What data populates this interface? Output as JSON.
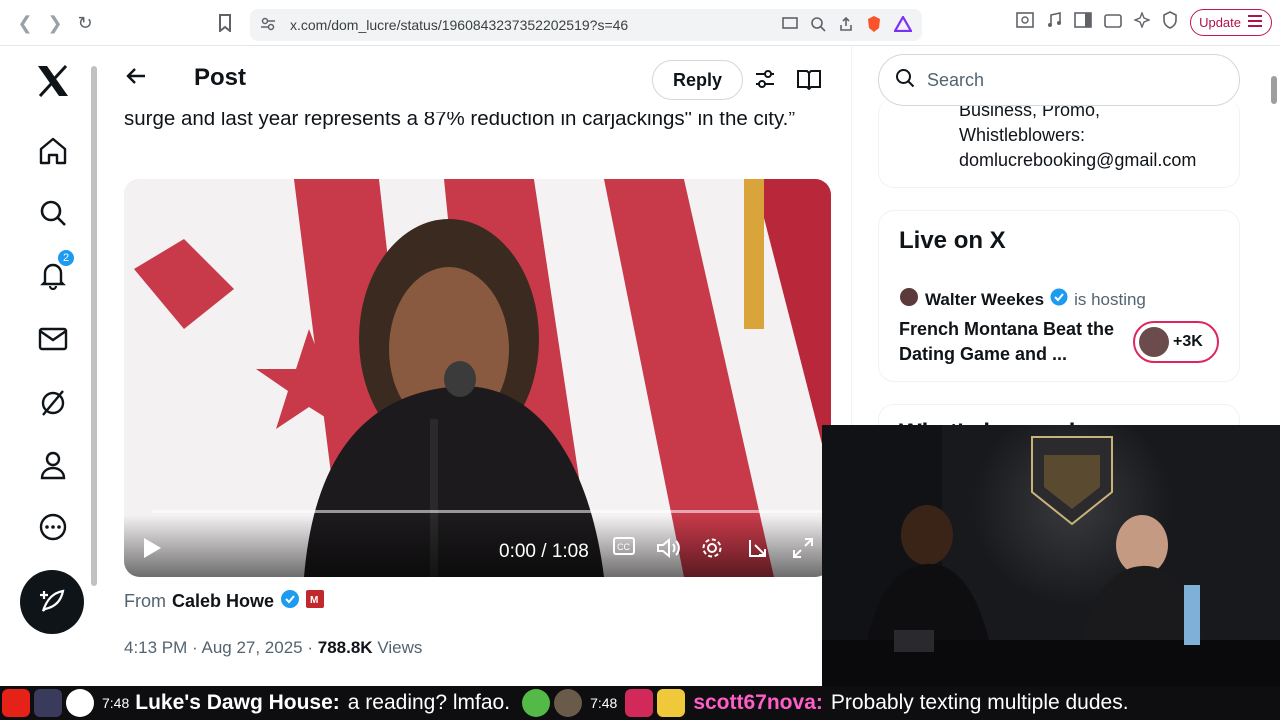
{
  "browser": {
    "url": "x.com/dom_lucre/status/1960843237352202519?s=46",
    "update_label": "Update"
  },
  "nav": {
    "notifications_badge": "2"
  },
  "header": {
    "title": "Post",
    "reply_label": "Reply"
  },
  "post": {
    "text": "surge and last year represents a 87% reduction in carjackings\" in the city.”",
    "video_time": "0:00 / 1:08",
    "from_prefix": "From",
    "from_name": "Caleb Howe",
    "timestamp": "4:13 PM · Aug 27, 2025 ·",
    "views_count": "788.8K",
    "views_label": "Views"
  },
  "sidebar": {
    "search_placeholder": "Search",
    "bio_line1": "Business, Promo,",
    "bio_line2": "Whistleblowers:",
    "bio_line3": "domlucrebooking@gmail.com",
    "live_title": "Live on X",
    "host_name": "Walter Weekes",
    "host_suffix": "is hosting",
    "space_title": "French Montana Beat the Dating Game and ...",
    "listeners": "+3K",
    "next_section": "What's happening"
  },
  "chat": {
    "time1": "7:48",
    "user1": "Luke's Dawg House:",
    "msg1": "a reading? lmfao.",
    "time2": "7:48",
    "user2": "scott67nova:",
    "msg2": "Probably texting multiple dudes."
  },
  "colors": {
    "accent": "#1d9bf0",
    "live_ring": "#e0245e",
    "chat_name": "#ff5ec7"
  }
}
